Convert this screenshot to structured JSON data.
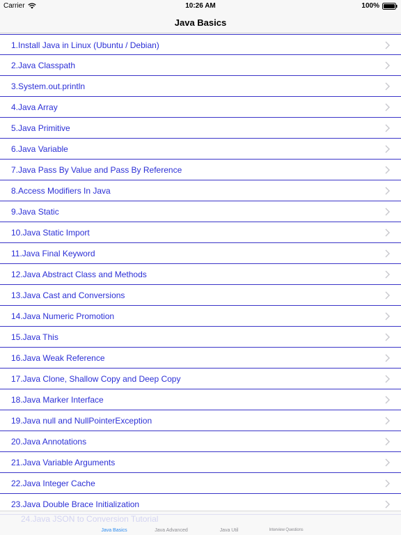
{
  "status_bar": {
    "carrier": "Carrier",
    "time": "10:26 AM",
    "battery": "100%"
  },
  "nav": {
    "title": "Java Basics"
  },
  "list": {
    "items": [
      "1.Install Java in Linux (Ubuntu / Debian)",
      "2.Java Classpath",
      "3.System.out.println",
      "4.Java Array",
      "5.Java Primitive",
      "6.Java Variable",
      "7.Java Pass By Value and Pass By Reference",
      "8.Access Modifiers In Java",
      "9.Java Static",
      "10.Java Static Import",
      "11.Java Final Keyword",
      "12.Java Abstract Class and Methods",
      "13.Java Cast and Conversions",
      "14.Java Numeric Promotion",
      "15.Java This",
      "16.Java Weak Reference",
      "17.Java Clone, Shallow Copy and Deep Copy",
      "18.Java Marker Interface",
      "19.Java null and NullPointerException",
      "20.Java Annotations",
      "21.Java Variable Arguments",
      "22.Java Integer Cache",
      "23.Java Double Brace Initialization"
    ],
    "partial_item": "24.Java JSON to Conversion Tutorial"
  },
  "tabs": [
    "Java Basics",
    "Java Advanced",
    "Java Util",
    "Interview Questions"
  ],
  "colors": {
    "accent": "#2b2fd6",
    "separator": "#3a35c8",
    "tab_active": "#2d8cf0"
  }
}
